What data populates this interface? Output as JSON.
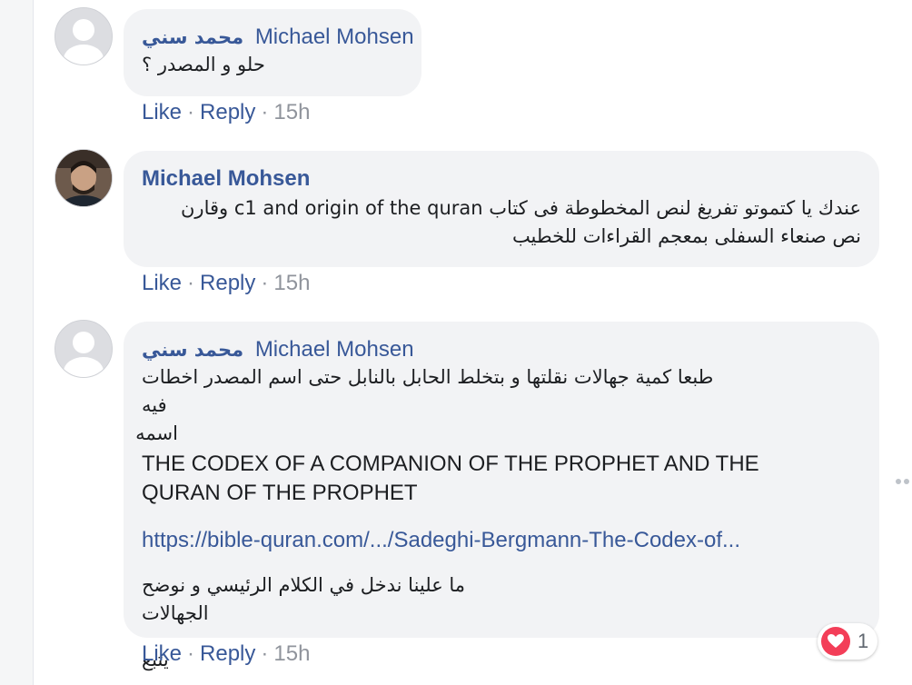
{
  "comments": [
    {
      "author_ar": "محمد سني",
      "tag": "Michael Mohsen",
      "lines": [
        "حلو و المصدر ؟"
      ],
      "actions": {
        "like": "Like",
        "reply": "Reply",
        "time": "15h"
      }
    },
    {
      "author": "Michael Mohsen",
      "lines": [
        "عندك يا كتموتو تفريغ لنص المخطوطة فى كتاب c1 and origin of the quran وقارن",
        "نص صنعاء السفلى بمعجم القراءات للخطيب"
      ],
      "actions": {
        "like": "Like",
        "reply": "Reply",
        "time": "15h"
      }
    },
    {
      "author_ar": "محمد سني",
      "tag": "Michael Mohsen",
      "ar_line1": "طبعا كمية جهالات نقلتها و بتخلط الحابل بالنابل حتى اسم المصدر اخطات فيه",
      "ar_line2": "اسمه",
      "en_line1": "THE CODEX OF A COMPANION OF THE PROPHET AND THE",
      "en_line2": "QURAN OF THE PROPHET",
      "link": "https://bible-quran.com/.../Sadeghi-Bergmann-The-Codex-of...",
      "ar_line3": "ما علينا ندخل في الكلام الرئيسي و نوضح الجهالات",
      "ar_line4": "يتبع",
      "actions": {
        "like": "Like",
        "reply": "Reply",
        "time": "15h"
      },
      "reaction": {
        "icon": "heart-icon",
        "count": "1"
      }
    }
  ],
  "colors": {
    "link": "#385898",
    "bubble": "#f2f3f5",
    "meta": "#90949c",
    "love": "#f33e58"
  }
}
